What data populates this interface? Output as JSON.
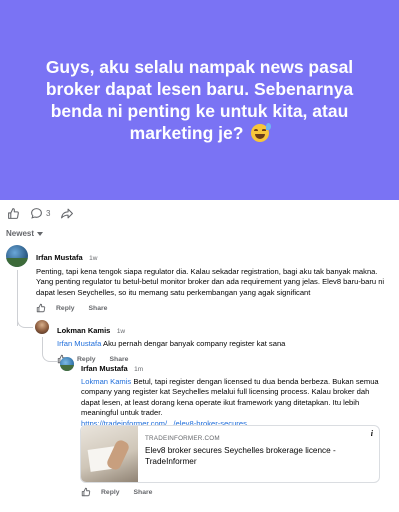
{
  "post": {
    "text": "Guys, aku selalu nampak news pasal broker dapat lesen baru. Sebenarnya benda ni penting ke untuk kita, atau marketing je?",
    "emoji_icon": "grinning-sweat-emoji",
    "background_color": "#7a73f4"
  },
  "actions": {
    "like_icon": "thumbs-up-icon",
    "comment_icon": "comment-bubble-icon",
    "comment_count": "3",
    "share_icon": "share-arrow-icon"
  },
  "sort": {
    "label": "Newest"
  },
  "comments": [
    {
      "author": "Irfan Mustafa",
      "time": "1w",
      "text": "Penting, tapi kena tengok siapa regulator dia. Kalau sekadar registration, bagi aku tak banyak makna. Yang penting regulator tu betul-betul monitor broker dan ada requirement yang jelas. Elev8 baru-baru ni dapat lesen Seychelles, so itu memang satu perkembangan yang agak significant",
      "reply_label": "Reply",
      "share_label": "Share"
    },
    {
      "author": "Lokman Kamis",
      "time": "1w",
      "mention": "Irfan Mustafa",
      "text": "Aku pernah dengar banyak company register kat sana",
      "reply_label": "Reply",
      "share_label": "Share"
    },
    {
      "author": "Irfan Mustafa",
      "time": "1m",
      "mention": "Lokman Kamis",
      "text": "Betul, tapi register dengan licensed tu dua benda berbeza. Bukan semua company yang register kat Seychelles melalui full licensing process. Kalau broker dah dapat lesen, at least dorang kena operate ikut framework yang ditetapkan. Itu lebih meaningful untuk trader.",
      "link": "https://tradeinformer.com/.../elev8-broker-secures...",
      "reply_label": "Reply",
      "share_label": "Share"
    }
  ],
  "link_card": {
    "domain": "TRADEINFORMER.COM",
    "title": "Elev8 broker secures Seychelles brokerage licence - TradeInformer",
    "info_label": "i"
  }
}
